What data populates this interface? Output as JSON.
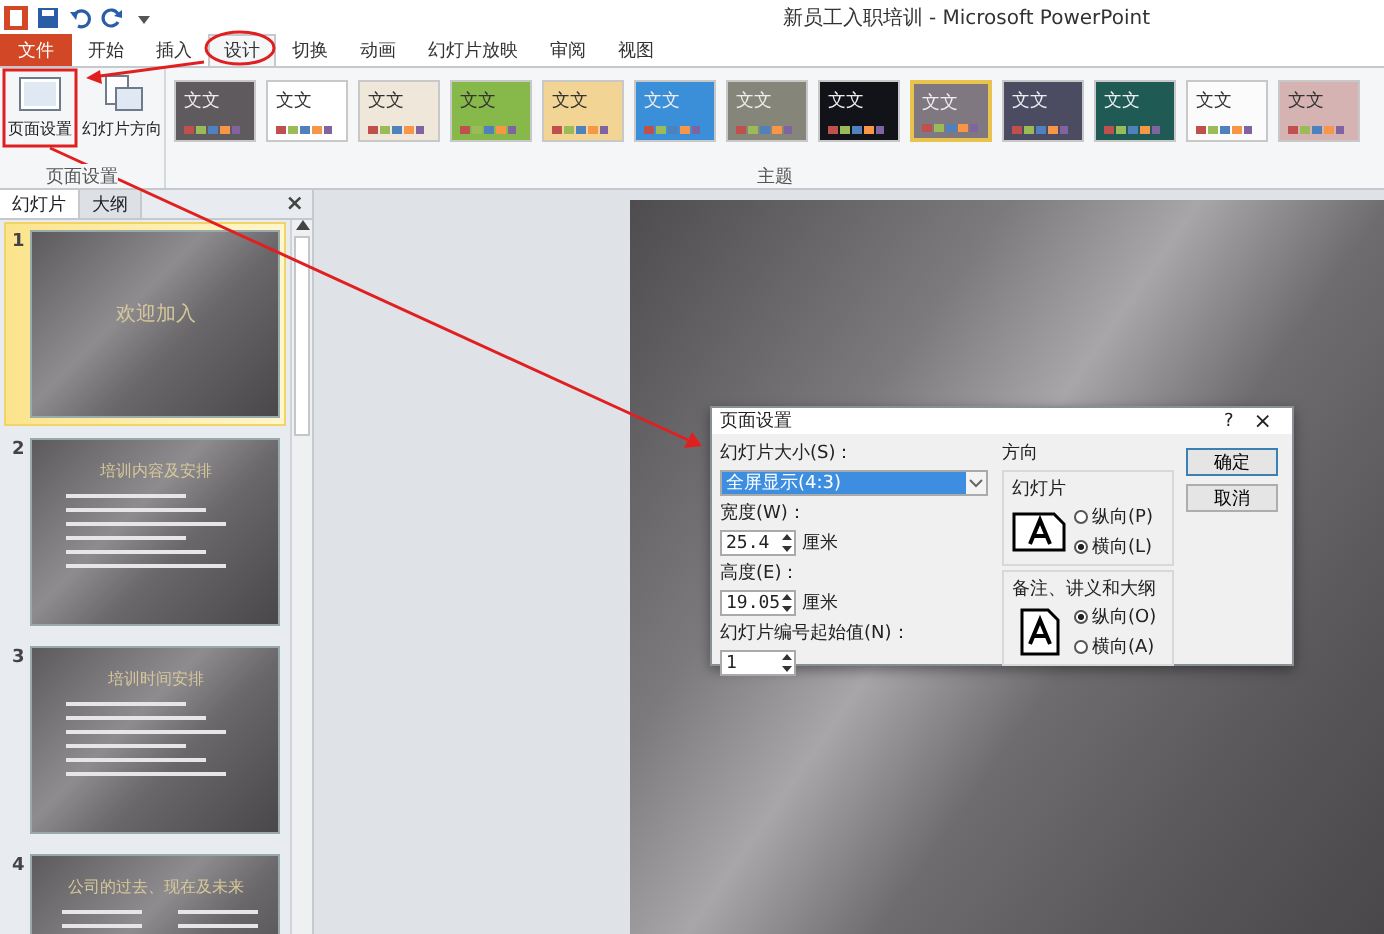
{
  "window": {
    "title": "新员工入职培训 - Microsoft PowerPoint"
  },
  "ribbon_tabs": [
    {
      "label": "文件",
      "kind": "file",
      "selected": false
    },
    {
      "label": "开始",
      "kind": "tab",
      "selected": false
    },
    {
      "label": "插入",
      "kind": "tab",
      "selected": false
    },
    {
      "label": "设计",
      "kind": "tab",
      "selected": true
    },
    {
      "label": "切换",
      "kind": "tab",
      "selected": false
    },
    {
      "label": "动画",
      "kind": "tab",
      "selected": false
    },
    {
      "label": "幻灯片放映",
      "kind": "tab",
      "selected": false
    },
    {
      "label": "审阅",
      "kind": "tab",
      "selected": false
    },
    {
      "label": "视图",
      "kind": "tab",
      "selected": false
    }
  ],
  "page_setup_group": {
    "label": "页面设置",
    "buttons": [
      {
        "label": "页面设置",
        "kind": "page"
      },
      {
        "label": "幻灯片方向",
        "kind": "orientation"
      }
    ]
  },
  "themes": {
    "label": "主题",
    "items": [
      {
        "label": "文文",
        "color": "#5e5a5e",
        "selected": false
      },
      {
        "label": "文文",
        "color": "#ffffff",
        "selected": false
      },
      {
        "label": "文文",
        "color": "#efe8da",
        "selected": false
      },
      {
        "label": "文文",
        "color": "#86b84a",
        "selected": false
      },
      {
        "label": "文文",
        "color": "#f2d595",
        "selected": false
      },
      {
        "label": "文文",
        "color": "#3b8fd9",
        "selected": false
      },
      {
        "label": "文文",
        "color": "#85857a",
        "selected": false
      },
      {
        "label": "文文",
        "color": "#111318",
        "selected": false
      },
      {
        "label": "文文",
        "color": "#807880",
        "selected": true
      },
      {
        "label": "文文",
        "color": "#4b4b62",
        "selected": false
      },
      {
        "label": "文文",
        "color": "#1f5a55",
        "selected": false
      },
      {
        "label": "文文",
        "color": "#fbfbfb",
        "selected": false
      },
      {
        "label": "文文",
        "color": "#d6b3b3",
        "selected": false
      }
    ]
  },
  "slide_panel": {
    "tabs": [
      {
        "label": "幻灯片",
        "selected": true
      },
      {
        "label": "大纲",
        "selected": false
      }
    ],
    "close": "×",
    "slides": [
      {
        "number": "1",
        "title": "欢迎加入",
        "kind": "title",
        "selected": true
      },
      {
        "number": "2",
        "title": "培训内容及安排",
        "kind": "bullets",
        "selected": false
      },
      {
        "number": "3",
        "title": "培训时间安排",
        "kind": "bullets",
        "selected": false
      },
      {
        "number": "4",
        "title": "公司的过去、现在及未来",
        "kind": "columns",
        "selected": false
      }
    ]
  },
  "dialog": {
    "title": "页面设置",
    "help": "?",
    "close": "×",
    "size_label": "幻灯片大小(S)：",
    "size_value": "全屏显示(4:3)",
    "width_label": "宽度(W)：",
    "width_value": "25.4",
    "width_unit": "厘米",
    "height_label": "高度(E)：",
    "height_value": "19.05",
    "height_unit": "厘米",
    "start_label": "幻灯片编号起始值(N)：",
    "start_value": "1",
    "orientation_label": "方向",
    "groups": [
      {
        "label": "幻灯片",
        "options": [
          {
            "label": "纵向(P)",
            "selected": false
          },
          {
            "label": "横向(L)",
            "selected": true
          }
        ]
      },
      {
        "label": "备注、讲义和大纲",
        "options": [
          {
            "label": "纵向(O)",
            "selected": true
          },
          {
            "label": "横向(A)",
            "selected": false
          }
        ]
      }
    ],
    "buttons": [
      {
        "label": "确定",
        "default": true
      },
      {
        "label": "取消",
        "default": false
      }
    ]
  }
}
